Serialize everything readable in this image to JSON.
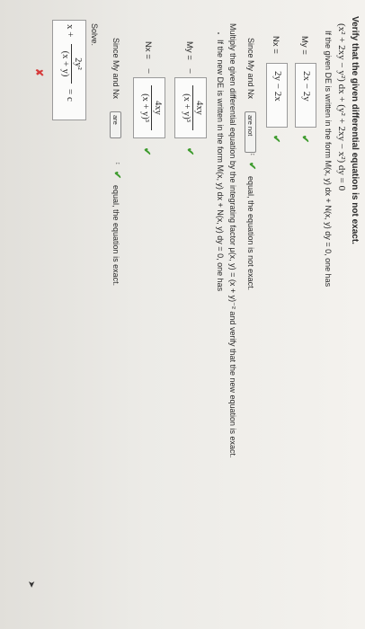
{
  "problem": {
    "intro": "Verify that the given differential equation is not exact.",
    "equation": "(x² + 2xy − y²) dx + (y² + 2xy − x²) dy = 0",
    "form_prompt": "If the given DE is written in the form M(x, y) dx + N(x, y) dy = 0, one has"
  },
  "partials": {
    "My_label": "My =",
    "My_value": "2x − 2y",
    "Nx_label": "Nx =",
    "Nx_value": "2y − 2x"
  },
  "since_1": {
    "prefix": "Since My and Nx",
    "select_value": "are not",
    "suffix": "equal, the equation is not exact."
  },
  "multiply": {
    "text": "Multiply the given differential equation by the integrating factor μ(x, y) = (x + y)⁻² and verify that the new equation is exact.",
    "form_prompt": "If the new DE is written in the form M(x, y) dx + N(x, y) dy = 0, one has"
  },
  "partials_new": {
    "My_label": "My =",
    "My_num": "4xy",
    "My_den": "(x + y)³",
    "My_sign": "−",
    "Nx_label": "Nx =",
    "Nx_num": "4xy",
    "Nx_den": "(x + y)³",
    "Nx_sign": "−"
  },
  "since_2": {
    "prefix": "Since My and Nx",
    "select_value": "are",
    "suffix": "equal, the equation is exact."
  },
  "solve": {
    "label": "Solve.",
    "lhs": "x +",
    "num": "2y²",
    "den": "(x + y)",
    "rhs": "= c"
  },
  "feedback": {
    "correct": "✔",
    "incorrect": "✘"
  }
}
